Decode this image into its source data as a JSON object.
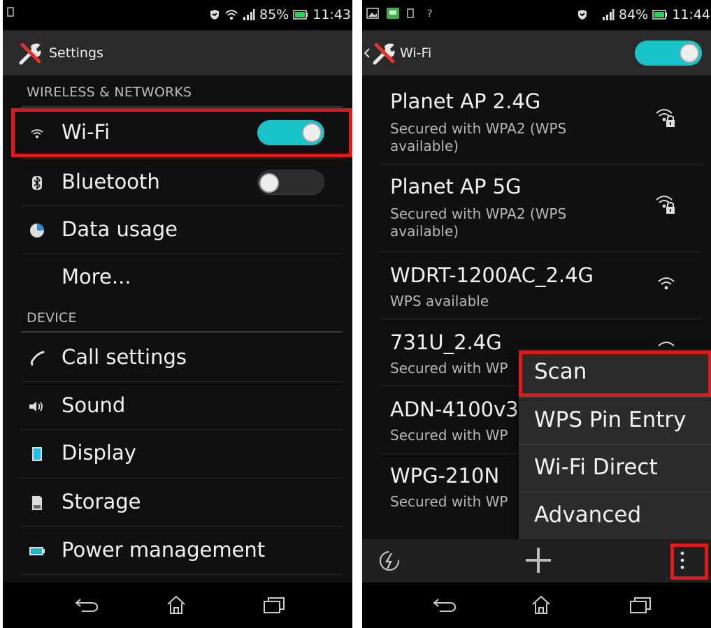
{
  "left": {
    "status_bar": {
      "battery": "85%",
      "time": "11:43"
    },
    "action_bar": {
      "title": "Settings",
      "icon": "tools-icon"
    },
    "sections": {
      "wireless": "WIRELESS & NETWORKS",
      "device": "DEVICE"
    },
    "items": {
      "wifi": {
        "label": "Wi-Fi",
        "state": "on"
      },
      "bluetooth": {
        "label": "Bluetooth",
        "state": "off"
      },
      "data_usage": {
        "label": "Data usage"
      },
      "more": {
        "label": "More..."
      },
      "call_settings": {
        "label": "Call settings"
      },
      "sound": {
        "label": "Sound"
      },
      "display": {
        "label": "Display"
      },
      "storage": {
        "label": "Storage"
      },
      "power": {
        "label": "Power management"
      }
    }
  },
  "right": {
    "status_bar": {
      "battery": "84%",
      "time": "11:44"
    },
    "action_bar": {
      "title": "Wi-Fi",
      "wifi_state": "on"
    },
    "networks": [
      {
        "name": "Planet AP 2.4G",
        "sub1": "Secured with WPA2 (WPS",
        "sub2": "available)",
        "secured": true
      },
      {
        "name": "Planet AP 5G",
        "sub1": "Secured with WPA2 (WPS",
        "sub2": "available)",
        "secured": true
      },
      {
        "name": "WDRT-1200AC_2.4G",
        "sub1": "WPS available",
        "secured": false
      },
      {
        "name": "731U_2.4G",
        "sub1": "Secured with WP"
      },
      {
        "name": "ADN-4100v3",
        "sub1": "Secured with WP"
      },
      {
        "name": "WPG-210N",
        "sub1": "Secured with WP"
      }
    ],
    "menu": {
      "scan": "Scan",
      "wps_pin": "WPS Pin Entry",
      "wifi_direct": "Wi-Fi Direct",
      "advanced": "Advanced"
    }
  },
  "colors": {
    "accent": "#17c3c8",
    "highlight_box": "#e0191b",
    "background": "#101010"
  }
}
